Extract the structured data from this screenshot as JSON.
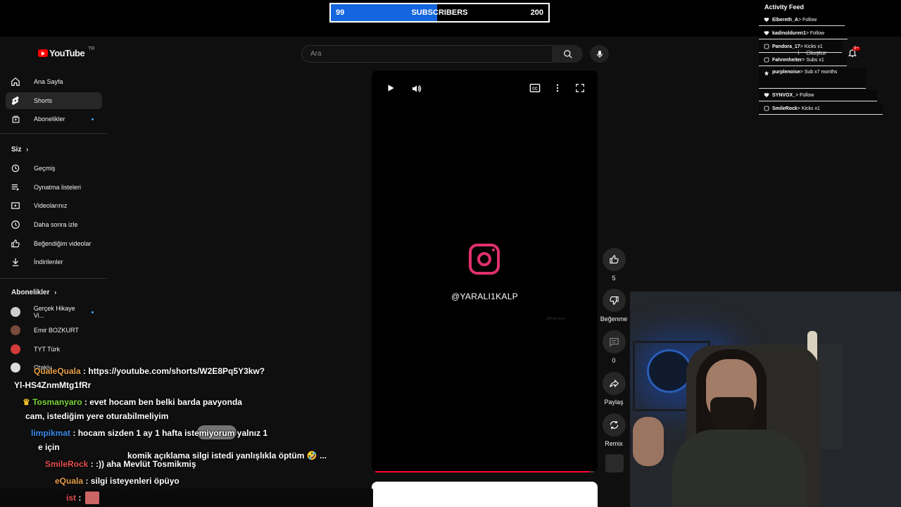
{
  "overlay": {
    "sub_goal": {
      "current": "99",
      "label": "SUBSCRIBERS",
      "target": "200",
      "progress": 0.49
    }
  },
  "header": {
    "logo_text": "YouTube",
    "region": "TR",
    "search_placeholder": "Ara",
    "create_label": "Oluştur",
    "notification_count": "9+"
  },
  "sidebar": {
    "main": [
      {
        "label": "Ana Sayfa",
        "icon": "home-icon"
      },
      {
        "label": "Shorts",
        "icon": "shorts-icon"
      },
      {
        "label": "Abonelikler",
        "icon": "subscriptions-icon"
      }
    ],
    "you_heading": "Siz",
    "you_items": [
      {
        "label": "Geçmiş",
        "icon": "history-icon"
      },
      {
        "label": "Oynatma listeleri",
        "icon": "playlist-icon"
      },
      {
        "label": "Videolarınız",
        "icon": "video-icon"
      },
      {
        "label": "Daha sonra izle",
        "icon": "clock-icon"
      },
      {
        "label": "Beğendiğim videolar",
        "icon": "thumbs-up-icon"
      },
      {
        "label": "İndirilenler",
        "icon": "download-icon"
      }
    ],
    "subs_heading": "Abonelikler",
    "subs": [
      {
        "label": "Gerçek Hikaye Vi...",
        "color": "#cccccc"
      },
      {
        "label": "Emir BOZKURT",
        "color": "#7a4a3a"
      },
      {
        "label": "TYT Türk",
        "color": "#d23b3b"
      },
      {
        "label": "Otakiy",
        "color": "#dddddd"
      }
    ]
  },
  "player": {
    "handle": "@YARALI1KALP",
    "watermark": "@frmlrybms",
    "progress": 0.98
  },
  "actions": {
    "like_count": "5",
    "dislike_label": "Beğenme",
    "comment_count": "0",
    "share_label": "Paylaş",
    "remix_label": "Remix"
  },
  "feed": {
    "title": "Activity Feed",
    "items": [
      {
        "icon": "heart-icon",
        "user": "Elbereth_A",
        "event": " > Follow"
      },
      {
        "icon": "heart-icon",
        "user": "kadinolduren1",
        "event": " > Follow"
      },
      {
        "icon": "kick-icon",
        "user": "Pandora_17",
        "event": " > Kicks x1"
      },
      {
        "icon": "kick-icon",
        "user": "Fahrenheiter",
        "event": " > Subs x1"
      },
      {
        "icon": "star-icon",
        "user": "purplenoise",
        "event": " > Sub x7 months"
      },
      {
        "icon": "heart-icon",
        "user": "SYNVOX_",
        "event": " > Follow"
      },
      {
        "icon": "kick-icon",
        "user": "SmileRock",
        "event": " > Kicks x1"
      }
    ]
  },
  "chat": [
    {
      "user": "QualeQuala",
      "sep": " : ",
      "text": "https://youtube.com/shorts/W2E8Pq5Y3kw?"
    },
    {
      "user": "",
      "sep": "",
      "text": "Yl-HS4ZnmMtg1fRr"
    },
    {
      "user": "Tosmanyaro",
      "sep": " : ",
      "text": "evet hocam ben belki barda pavyonda"
    },
    {
      "user": "",
      "sep": "",
      "text": "cam, istediğim yere oturabilmeliyim"
    },
    {
      "user": "limpikmat",
      "sep": " : ",
      "text": "hocam sizden 1 ay 1 hafta istemiyorum yalnız 1"
    },
    {
      "user": "",
      "sep": "",
      "text": "e için"
    },
    {
      "user": "",
      "sep": "",
      "text": "komik açıklama silgi istedi yanlışlıkla öptüm 🤣 ..."
    },
    {
      "user": "SmileRock",
      "sep": " : ",
      "text": ":)) aha Mevlüt Tosmikmiş"
    },
    {
      "user": "eQuala",
      "sep": " : ",
      "text": "silgi isteyenleri öpüyo"
    },
    {
      "user": "ist",
      "sep": " : ",
      "text": ""
    }
  ],
  "colors": {
    "accent": "#1565e0",
    "youtube_red": "#ff0000",
    "instagram": "#e1306c"
  }
}
